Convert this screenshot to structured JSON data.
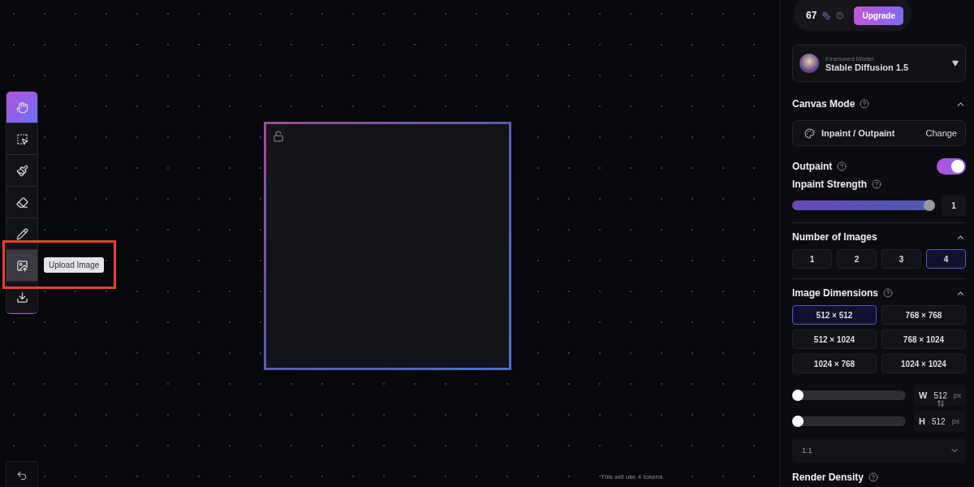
{
  "toolbar": {
    "tools": [
      {
        "kind": "hand",
        "selected": true,
        "hovered": false
      },
      {
        "kind": "select",
        "selected": false,
        "hovered": false
      },
      {
        "kind": "brush",
        "selected": false,
        "hovered": false
      },
      {
        "kind": "eraser",
        "selected": false,
        "hovered": false
      },
      {
        "kind": "pencil",
        "selected": false,
        "hovered": false
      },
      {
        "kind": "upload",
        "selected": false,
        "hovered": true
      },
      {
        "kind": "download",
        "selected": false,
        "hovered": false
      }
    ],
    "tooltip": "Upload Image"
  },
  "canvas": {
    "locked": false,
    "footer": "This will use 4 tokens."
  },
  "sidebar": {
    "tokens": {
      "count": "67",
      "upgrade": "Upgrade"
    },
    "model": {
      "caption": "Finetuned Model",
      "name": "Stable Diffusion 1.5"
    },
    "canvas_mode": {
      "title": "Canvas Mode",
      "expanded": true,
      "mode": "Inpaint / Outpaint",
      "change": "Change"
    },
    "outpaint": {
      "label": "Outpaint",
      "on": true
    },
    "inpaint_strength": {
      "label": "Inpaint Strength",
      "level": 0.97,
      "value": "1"
    },
    "number_of_images": {
      "title": "Number of Images",
      "expanded": true,
      "options": [
        {
          "label": "1",
          "selected": false
        },
        {
          "label": "2",
          "selected": false
        },
        {
          "label": "3",
          "selected": false
        },
        {
          "label": "4",
          "selected": true
        }
      ]
    },
    "image_dimensions": {
      "title": "Image Dimensions",
      "expanded": true,
      "options": [
        {
          "label": "512 × 512",
          "selected": true
        },
        {
          "label": "768 × 768",
          "selected": false
        },
        {
          "label": "512 × 1024",
          "selected": false
        },
        {
          "label": "768 × 1024",
          "selected": false
        },
        {
          "label": "1024 × 768",
          "selected": false
        },
        {
          "label": "1024 × 1024",
          "selected": false
        }
      ],
      "width": {
        "label": "W",
        "value": "512",
        "unit": "px",
        "level": 0
      },
      "height": {
        "label": "H",
        "value": "512",
        "unit": "px",
        "level": 0
      },
      "aspect_ratio": "1:1"
    },
    "render_density": {
      "title": "Render Density"
    }
  }
}
